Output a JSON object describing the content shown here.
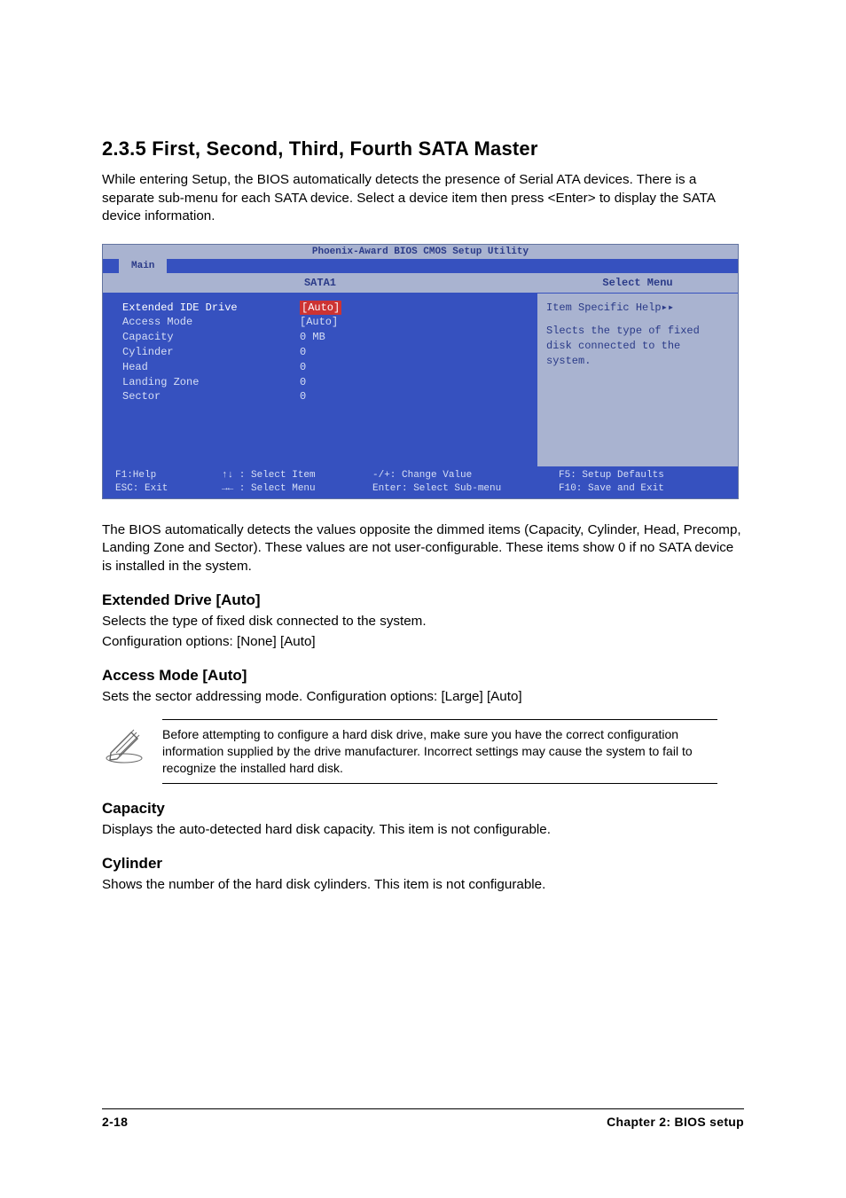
{
  "heading": "2.3.5   First, Second, Third, Fourth SATA Master",
  "intro": "While entering Setup, the BIOS automatically detects the presence of Serial ATA devices. There is a separate sub-menu for each SATA device. Select a device item then press <Enter> to display the SATA device information.",
  "bios": {
    "title": "Phoenix-Award BIOS CMOS Setup Utility",
    "tab": "Main",
    "left_header": "SATA1",
    "rows": [
      {
        "label": "Extended IDE Drive",
        "value": "[Auto]",
        "selected": true
      },
      {
        "label": "Access Mode",
        "value": "[Auto]",
        "selected": false
      },
      {
        "label": "",
        "value": "",
        "selected": false
      },
      {
        "label": "Capacity",
        "value": "   0 MB",
        "selected": false
      },
      {
        "label": "",
        "value": "",
        "selected": false
      },
      {
        "label": "Cylinder",
        "value": "   0",
        "selected": false
      },
      {
        "label": "Head",
        "value": "   0",
        "selected": false
      },
      {
        "label": "Landing Zone",
        "value": "   0",
        "selected": false
      },
      {
        "label": "Sector",
        "value": "   0",
        "selected": false
      }
    ],
    "right_header": "Select Menu",
    "help_title": "Item Specific Help▸▸",
    "help_text": "Slects the type of fixed disk connected to the system.",
    "footer": {
      "col1a": "F1:Help",
      "col1b": "ESC: Exit",
      "col2a": "↑↓ : Select Item",
      "col2b": "→← : Select Menu",
      "col3a": "-/+: Change Value",
      "col3b": "Enter: Select Sub-menu",
      "col4a": "F5: Setup Defaults",
      "col4b": "F10: Save and Exit"
    }
  },
  "after_bios": "The BIOS automatically detects the values opposite the dimmed items (Capacity, Cylinder,  Head, Precomp, Landing Zone and Sector). These values are not user-configurable. These items show 0 if no SATA device is installed in the system.",
  "ext_drive_h": "Extended Drive [Auto]",
  "ext_drive_p1": "Selects the type of fixed disk connected to the system.",
  "ext_drive_p2": "Configuration options: [None] [Auto]",
  "access_mode_h": "Access Mode [Auto]",
  "access_mode_p": "Sets the sector addressing mode. Configuration options: [Large] [Auto]",
  "note": "Before attempting to configure a hard disk drive, make sure you have the correct configuration information supplied by the drive manufacturer. Incorrect settings may cause the system to fail to recognize the installed hard disk.",
  "capacity_h": "Capacity",
  "capacity_p": "Displays the auto-detected hard disk capacity. This item is not configurable.",
  "cylinder_h": "Cylinder",
  "cylinder_p": "Shows the number of the hard disk cylinders. This item is not configurable.",
  "footer_left": "2-18",
  "footer_right": "Chapter 2: BIOS setup"
}
